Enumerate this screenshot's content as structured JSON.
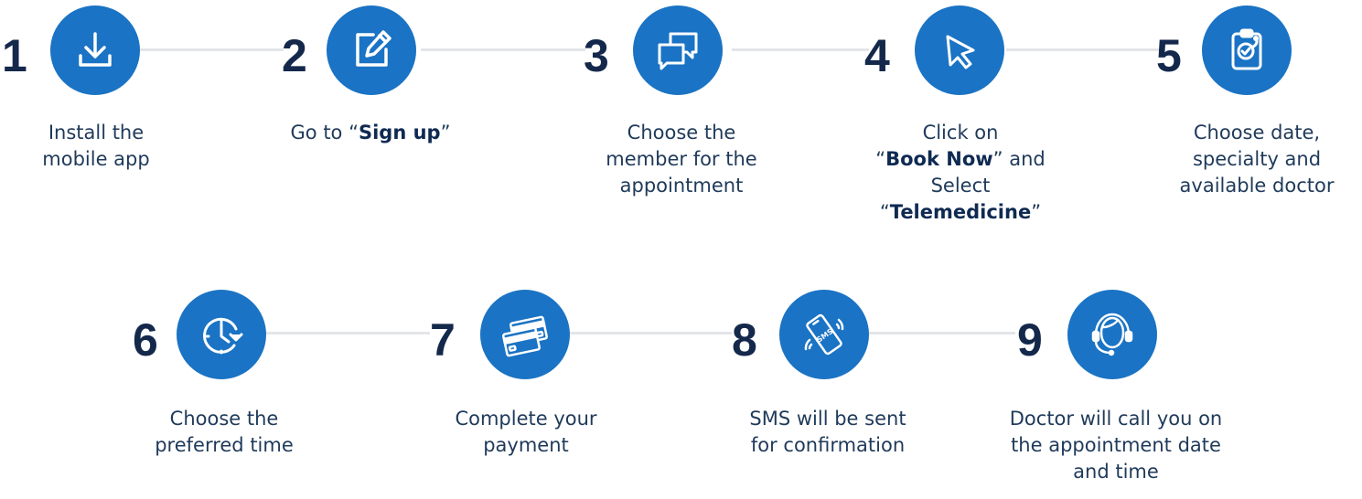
{
  "colors": {
    "accent": "#1a73c4",
    "number": "#14284b",
    "connector": "#e3e5e9",
    "text": "#1f3a5a"
  },
  "steps": [
    {
      "number": "1",
      "icon": "download-icon",
      "lines": [
        "Install the",
        "mobile app"
      ]
    },
    {
      "number": "2",
      "icon": "edit-icon",
      "line1_pre": "Go to “",
      "line1_bold": "Sign up",
      "line1_post": "”"
    },
    {
      "number": "3",
      "icon": "chat-bubbles-icon",
      "lines": [
        "Choose the",
        "member for the",
        "appointment"
      ]
    },
    {
      "number": "4",
      "icon": "cursor-icon",
      "line1": "Click on",
      "line2_pre": "“",
      "line2_bold": "Book Now",
      "line2_post": "” and",
      "line3": "Select",
      "line4_pre": "“",
      "line4_bold": "Telemedicine",
      "line4_post": "”"
    },
    {
      "number": "5",
      "icon": "clipboard-stethoscope-icon",
      "lines": [
        "Choose date,",
        "specialty and",
        "available doctor"
      ]
    },
    {
      "number": "6",
      "icon": "clock-icon",
      "lines": [
        "Choose the",
        "preferred time"
      ]
    },
    {
      "number": "7",
      "icon": "credit-cards-icon",
      "lines": [
        "Complete your",
        "payment"
      ]
    },
    {
      "number": "8",
      "icon": "sms-phone-icon",
      "lines": [
        "SMS will be sent",
        "for confirmation"
      ]
    },
    {
      "number": "9",
      "icon": "headset-agent-icon",
      "lines": [
        "Doctor will call you on",
        "the appointment date",
        "and time"
      ]
    }
  ]
}
